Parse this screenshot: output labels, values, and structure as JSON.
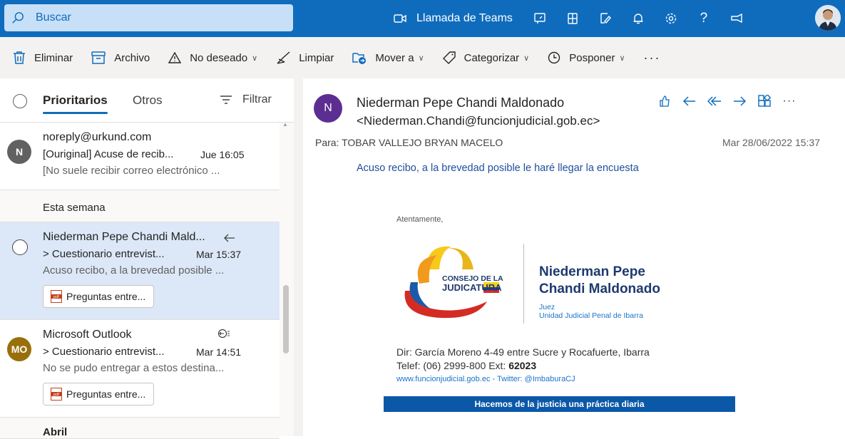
{
  "topbar": {
    "search_placeholder": "Buscar",
    "teams_label": "Llamada de Teams",
    "icons": [
      "video-icon",
      "whiteboard-icon",
      "office-icon",
      "compose-icon",
      "bell-icon",
      "gear-icon",
      "help-icon",
      "feedback-icon"
    ],
    "help_glyph": "?"
  },
  "commands": {
    "delete": "Eliminar",
    "archive": "Archivo",
    "junk": "No deseado",
    "sweep": "Limpiar",
    "move": "Mover a",
    "categorize": "Categorizar",
    "snooze": "Posponer",
    "more": "···",
    "chevron": "∨"
  },
  "list": {
    "tab_focused": "Prioritarios",
    "tab_other": "Otros",
    "filter": "Filtrar",
    "section_week": "Esta semana",
    "section_april": "Abril",
    "messages": [
      {
        "avatar": "N",
        "from": "noreply@urkund.com",
        "subject": "[Ouriginal] Acuse de recib...",
        "time": "Jue 16:05",
        "preview": "[No suele recibir correo electrónico ..."
      },
      {
        "from": "Niederman Pepe Chandi Mald...",
        "subject": "> Cuestionario entrevist...",
        "time": "Mar 15:37",
        "preview": "Acuso recibo, a la brevedad posible ...",
        "attachment": "Preguntas entre..."
      },
      {
        "avatar": "MO",
        "from": "Microsoft Outlook",
        "subject": "> Cuestionario entrevist...",
        "time": "Mar 14:51",
        "preview": "No se pudo entregar a estos destina...",
        "attachment": "Preguntas entre..."
      }
    ]
  },
  "reading": {
    "avatar": "N",
    "sender_name": "Niederman Pepe Chandi Maldonado",
    "sender_email": "<Niederman.Chandi@funcionjudicial.gob.ec>",
    "to": "Para:  TOBAR VALLEJO BRYAN MACELO",
    "date": "Mar 28/06/2022 15:37",
    "body": "Acuso recibo, a la brevedad posible le haré llegar la encuesta",
    "more": "···"
  },
  "signature": {
    "greeting": "Atentamente,",
    "logo_line1": "CONSEJO DE LA",
    "logo_line2": "JUDICATURA",
    "name_line1": "Niederman Pepe",
    "name_line2": "Chandi Maldonado",
    "role": "Juez",
    "unit": "Unidad Judicial Penal de Ibarra",
    "address": "Dir: García Moreno 4-49 entre Sucre y Rocafuerte, Ibarra",
    "phone_prefix": "Telef: (06) 2999-800 Ext: ",
    "phone_ext": "62023",
    "web": "www.funcionjudicial.gob.ec - Twitter: @ImbaburaCJ",
    "banner": "Hacemos de la justicia una práctica diaria"
  },
  "colors": {
    "brand": "#0f6cbd",
    "selected_row": "#dce8f7",
    "avatar_n": "#616161",
    "avatar_mo": "#986f0b",
    "reading_avatar": "#5c2e91"
  }
}
